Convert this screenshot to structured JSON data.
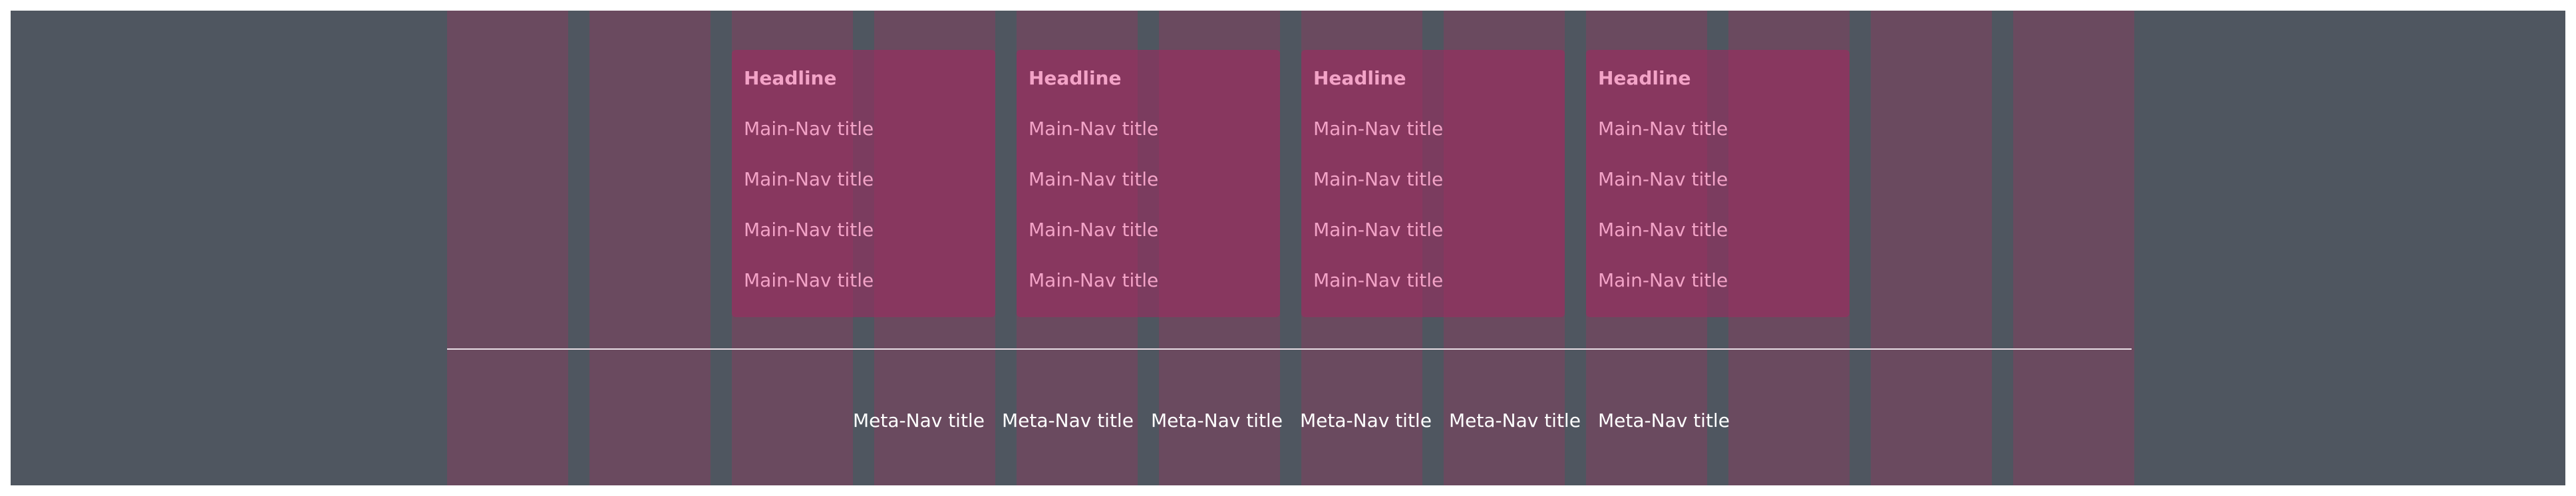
{
  "main_nav": {
    "columns": [
      {
        "headline": "Headline",
        "items": [
          "Main-Nav title",
          "Main-Nav title",
          "Main-Nav title",
          "Main-Nav title"
        ]
      },
      {
        "headline": "Headline",
        "items": [
          "Main-Nav title",
          "Main-Nav title",
          "Main-Nav title",
          "Main-Nav title"
        ]
      },
      {
        "headline": "Headline",
        "items": [
          "Main-Nav title",
          "Main-Nav title",
          "Main-Nav title",
          "Main-Nav title"
        ]
      },
      {
        "headline": "Headline",
        "items": [
          "Main-Nav title",
          "Main-Nav title",
          "Main-Nav title",
          "Main-Nav title"
        ]
      }
    ]
  },
  "meta_nav": {
    "items": [
      "Meta-Nav title",
      "Meta-Nav title",
      "Meta-Nav title",
      "Meta-Nav title",
      "Meta-Nav title",
      "Meta-Nav title"
    ]
  },
  "colors": {
    "background": "#4f5660",
    "grid_column": "#6a4a5f",
    "main_nav_panel": "#8a3560",
    "nav_text": "#f3a3c7",
    "meta_text": "#ffffff",
    "divider": "#e9dfe6"
  }
}
